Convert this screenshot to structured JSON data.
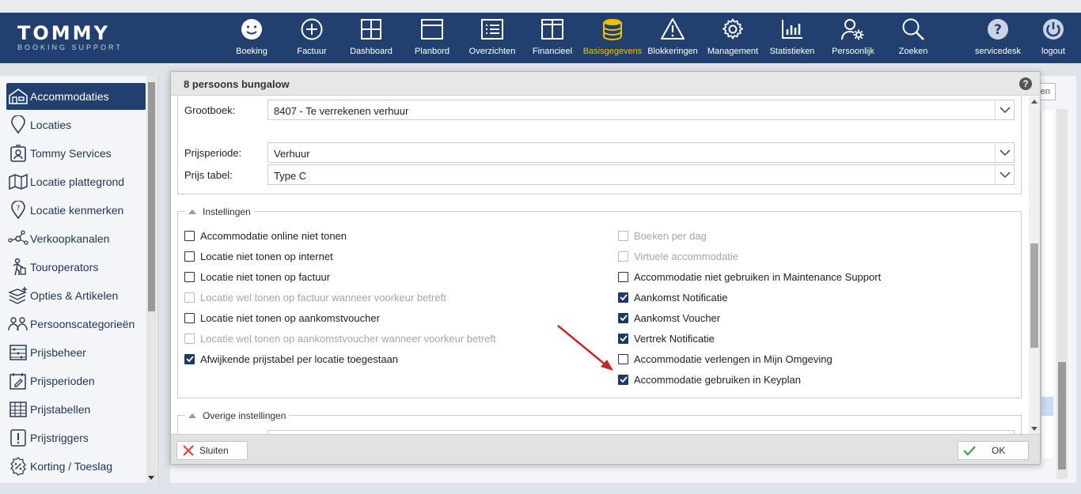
{
  "app": {
    "logo_main": "TOMMY",
    "logo_sub": "BOOKING SUPPORT"
  },
  "nav": {
    "items": [
      {
        "label": "Boeking",
        "icon": "smiley-icon"
      },
      {
        "label": "Factuur",
        "icon": "plus-circle-icon"
      },
      {
        "label": "Dashboard",
        "icon": "grid-icon"
      },
      {
        "label": "Planbord",
        "icon": "window-icon"
      },
      {
        "label": "Overzichten",
        "icon": "list-icon"
      },
      {
        "label": "Financieel",
        "icon": "columns-icon"
      },
      {
        "label": "Basisgegevens",
        "icon": "database-icon"
      },
      {
        "label": "Blokkeringen",
        "icon": "warning-icon"
      },
      {
        "label": "Management",
        "icon": "gear-icon"
      },
      {
        "label": "Statistieken",
        "icon": "bar-chart-icon"
      },
      {
        "label": "Persoonlijk",
        "icon": "user-settings-icon"
      },
      {
        "label": "Zoeken",
        "icon": "search-icon"
      },
      {
        "label": "servicedesk",
        "icon": "help-icon"
      },
      {
        "label": "logout",
        "icon": "power-icon"
      }
    ],
    "active": "Basisgegevens",
    "active_color": "#f0c000"
  },
  "sidebar": {
    "items": [
      {
        "label": "Accommodaties",
        "icon": "house-icon"
      },
      {
        "label": "Locaties",
        "icon": "map-pin-icon"
      },
      {
        "label": "Tommy Services",
        "icon": "badge-icon"
      },
      {
        "label": "Locatie plattegrond",
        "icon": "map-icon"
      },
      {
        "label": "Locatie kenmerken",
        "icon": "pin-question-icon"
      },
      {
        "label": "Verkoopkanalen",
        "icon": "network-icon"
      },
      {
        "label": "Touroperators",
        "icon": "traveler-icon"
      },
      {
        "label": "Opties & Artikelen",
        "icon": "layers-plus-icon"
      },
      {
        "label": "Persoonscategorieën",
        "icon": "people-icon"
      },
      {
        "label": "Prijsbeheer",
        "icon": "abacus-icon"
      },
      {
        "label": "Prijsperioden",
        "icon": "calendar-edit-icon"
      },
      {
        "label": "Prijstabellen",
        "icon": "table-icon"
      },
      {
        "label": "Prijstriggers",
        "icon": "exclamation-box-icon"
      },
      {
        "label": "Korting / Toeslag",
        "icon": "percent-icon"
      }
    ],
    "active": "Accommodaties"
  },
  "background": {
    "partial_button": "en"
  },
  "modal": {
    "title": "8 persoons bungalow",
    "help": "?",
    "fields": {
      "grootboek_label": "Grootboek:",
      "grootboek_value": "8407 - Te verrekenen verhuur",
      "prijsperiode_label": "Prijsperiode:",
      "prijsperiode_value": "Verhuur",
      "prijstabel_label": "Prijs tabel:",
      "prijstabel_value": "Type C"
    },
    "instellingen": {
      "legend": "Instellingen",
      "left": [
        {
          "label": "Accommodatie online niet tonen",
          "checked": false,
          "disabled": false
        },
        {
          "label": "Locatie niet tonen op internet",
          "checked": false,
          "disabled": false
        },
        {
          "label": "Locatie niet tonen op factuur",
          "checked": false,
          "disabled": false
        },
        {
          "label": "Locatie wel tonen op factuur wanneer voorkeur betreft",
          "checked": false,
          "disabled": true
        },
        {
          "label": "Locatie niet tonen op aankomstvoucher",
          "checked": false,
          "disabled": false
        },
        {
          "label": "Locatie wel tonen op aankomstvoucher wanneer voorkeur betreft",
          "checked": false,
          "disabled": true
        },
        {
          "label": "Afwijkende prijstabel per locatie toegestaan",
          "checked": true,
          "disabled": false
        }
      ],
      "right": [
        {
          "label": "Boeken per dag",
          "checked": false,
          "disabled": true
        },
        {
          "label": "Virtuele accommodatie",
          "checked": false,
          "disabled": true
        },
        {
          "label": "Accommodatie niet gebruiken in Maintenance Support",
          "checked": false,
          "disabled": false
        },
        {
          "label": "Aankomst Notificatie",
          "checked": true,
          "disabled": false
        },
        {
          "label": "Aankomst Voucher",
          "checked": true,
          "disabled": false
        },
        {
          "label": "Vertrek Notificatie",
          "checked": true,
          "disabled": false
        },
        {
          "label": "Accommodatie verlengen in Mijn Omgeving",
          "checked": false,
          "disabled": false
        },
        {
          "label": "Accommodatie gebruiken in Keyplan",
          "checked": true,
          "disabled": false
        }
      ]
    },
    "overige": {
      "legend": "Overige instellingen"
    },
    "footer": {
      "close_label": "Sluiten",
      "ok_label": "OK"
    }
  },
  "colors": {
    "nav_bg": "#22406f",
    "checked": "#1d3966",
    "annotation_arrow": "#c62828"
  }
}
